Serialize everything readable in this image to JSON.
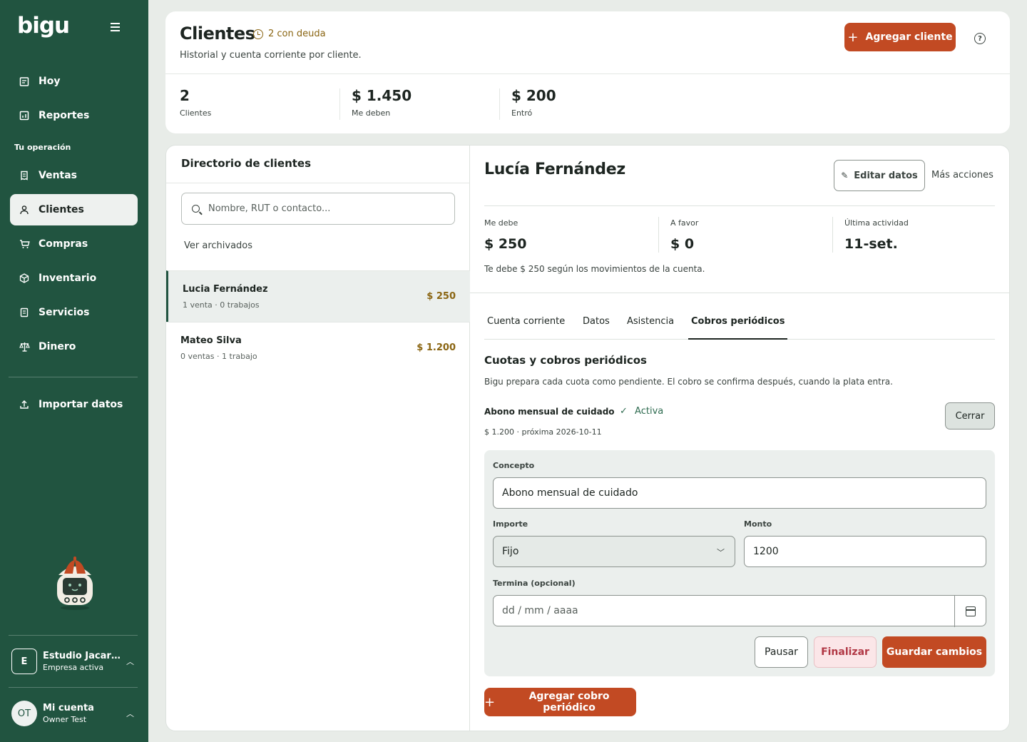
{
  "sidebar": {
    "logo": "bigu",
    "nav_top": [
      {
        "label": "Hoy"
      },
      {
        "label": "Reportes"
      }
    ],
    "section_label": "Tu operación",
    "nav_ops": [
      {
        "label": "Ventas"
      },
      {
        "label": "Clientes"
      },
      {
        "label": "Compras"
      },
      {
        "label": "Inventario"
      },
      {
        "label": "Servicios"
      },
      {
        "label": "Dinero"
      }
    ],
    "import_label": "Importar datos",
    "company": {
      "badge": "E",
      "name": "Estudio Jacarandá",
      "status": "Empresa activa"
    },
    "account": {
      "badge": "OT",
      "name": "Mi cuenta",
      "user": "Owner Test"
    }
  },
  "header": {
    "title": "Clientes",
    "debt_badge": "2 con deuda",
    "subtitle": "Historial y cuenta corriente por cliente.",
    "add_button": "Agregar cliente",
    "stats": [
      {
        "value": "2",
        "label": "Clientes"
      },
      {
        "value": "$ 1.450",
        "label": "Me deben"
      },
      {
        "value": "$ 200",
        "label": "Entró"
      }
    ]
  },
  "directory": {
    "title": "Directorio de clientes",
    "search_placeholder": "Nombre, RUT o contacto...",
    "archived_link": "Ver archivados",
    "clients": [
      {
        "name": "Lucia Fernández",
        "meta": "1 venta · 0 trabajos",
        "amount": "$ 250"
      },
      {
        "name": "Mateo Silva",
        "meta": "0 ventas · 1 trabajo",
        "amount": "$ 1.200"
      }
    ]
  },
  "detail": {
    "name": "Lucía Fernández",
    "edit_button": "Editar datos",
    "more_actions": "Más acciones",
    "kpis": [
      {
        "label": "Me debe",
        "value": "$ 250"
      },
      {
        "label": "A favor",
        "value": "$ 0"
      },
      {
        "label": "Última actividad",
        "value": "11-set."
      }
    ],
    "owe_note": "Te debe $ 250 según los movimientos de la cuenta.",
    "tabs": [
      {
        "label": "Cuenta corriente"
      },
      {
        "label": "Datos"
      },
      {
        "label": "Asistencia"
      },
      {
        "label": "Cobros periódicos"
      }
    ],
    "active_tab": "Cobros periódicos",
    "section_title": "Cuotas y cobros periódicos",
    "section_desc": "Bigu prepara cada cuota como pendiente. El cobro se confirma después, cuando la plata entra.",
    "plan": {
      "name": "Abono mensual de cuidado",
      "status": "Activa",
      "meta": "$ 1.200 · próxima 2026-10-11",
      "close_button": "Cerrar"
    },
    "form": {
      "concept_label": "Concepto",
      "concept_value": "Abono mensual de cuidado",
      "amount_type_label": "Importe",
      "amount_type_value": "Fijo",
      "amount_label": "Monto",
      "amount_value": "1200",
      "end_label": "Termina (opcional)",
      "end_placeholder": "dd / mm / aaaa",
      "pause_button": "Pausar",
      "finish_button": "Finalizar",
      "save_button": "Guardar cambios"
    },
    "add_period_button": "Agregar cobro periódico"
  },
  "colors": {
    "sidebar": "#215440",
    "accent": "#c24a23",
    "debt": "#8a6512",
    "active_status": "#2e6b50"
  }
}
